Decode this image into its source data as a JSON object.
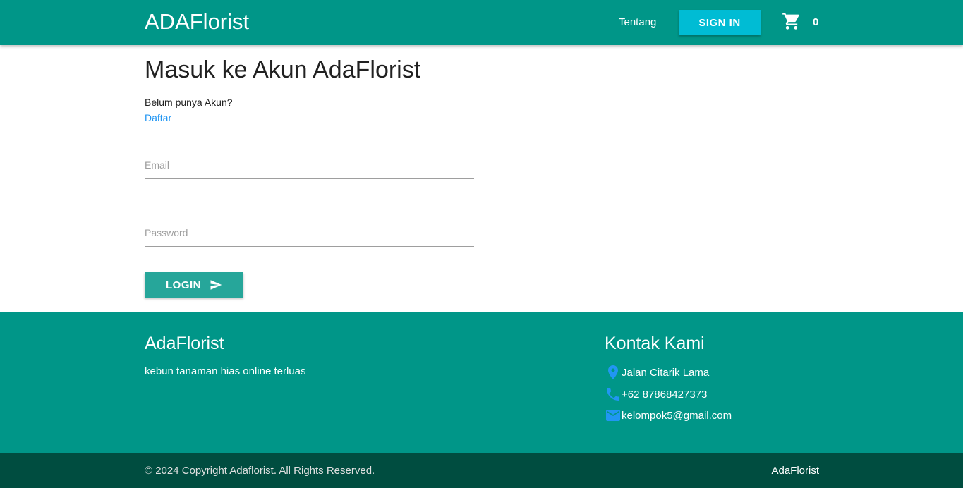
{
  "navbar": {
    "brand": "ADAFlorist",
    "link_about": "Tentang",
    "signin_label": "SIGN IN",
    "cart_icon": "shopping-cart-icon",
    "cart_count": "0"
  },
  "main": {
    "title": "Masuk ke Akun AdaFlorist",
    "no_account_text": "Belum punya Akun?",
    "register_link": "Daftar",
    "email_placeholder": "Email",
    "email_value": "",
    "password_placeholder": "Password",
    "password_value": "",
    "login_label": "LOGIN",
    "login_icon": "send-icon"
  },
  "footer": {
    "brand_title": "AdaFlorist",
    "tagline": "kebun tanaman hias online terluas",
    "contact_title": "Kontak Kami",
    "address": "Jalan Citarik Lama",
    "phone": "+62 87868427373",
    "email": "kelompok5@gmail.com",
    "copyright": "© 2024 Copyright Adaflorist. All Rights Reserved.",
    "bottom_brand": "AdaFlorist"
  },
  "colors": {
    "primary": "#009688",
    "secondary": "#00bcd4",
    "button": "#26a69a",
    "footer_dark": "#004d40",
    "link": "#2196f3"
  }
}
